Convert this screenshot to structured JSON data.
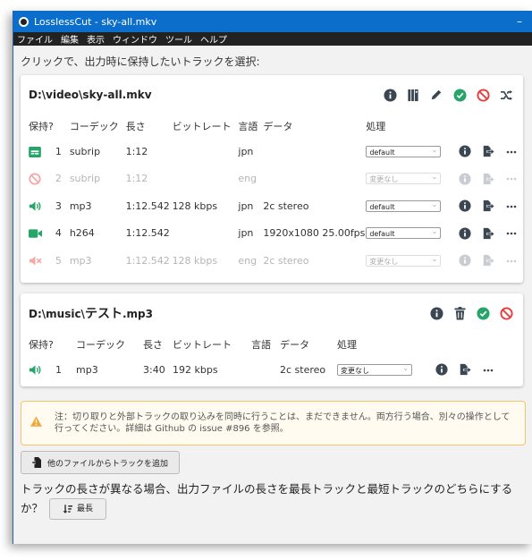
{
  "window": {
    "title": "LosslessCut - sky-all.mkv",
    "minimize": "–"
  },
  "menu": [
    "ファイル",
    "編集",
    "表示",
    "ウィンドウ",
    "ツール",
    "ヘルプ"
  ],
  "hint": "クリックで、出力時に保持したいトラックを選択:",
  "headers": {
    "keep": "保持?",
    "codec": "コーデック",
    "length": "長さ",
    "bitrate": "ビットレート",
    "lang": "言語",
    "data": "データ",
    "action": "処理"
  },
  "file1": {
    "path": "D:\\video\\sky-all.mkv",
    "tracks": [
      {
        "type": "subtitle",
        "index": "1",
        "codec": "subrip",
        "length": "1:12",
        "bitrate": "",
        "lang": "jpn",
        "data": "",
        "action": "default",
        "enabled": true
      },
      {
        "type": "disabled",
        "index": "2",
        "codec": "subrip",
        "length": "1:12",
        "bitrate": "",
        "lang": "eng",
        "data": "",
        "action": "変更なし",
        "enabled": false
      },
      {
        "type": "audio",
        "index": "3",
        "codec": "mp3",
        "length": "1:12.542",
        "bitrate": "128 kbps",
        "lang": "jpn",
        "data": "2c stereo",
        "action": "default",
        "enabled": true
      },
      {
        "type": "video",
        "index": "4",
        "codec": "h264",
        "length": "1:12.542",
        "bitrate": "",
        "lang": "jpn",
        "data": "1920x1080 25.00fps",
        "action": "default",
        "enabled": true
      },
      {
        "type": "muted",
        "index": "5",
        "codec": "mp3",
        "length": "1:12.542",
        "bitrate": "128 kbps",
        "lang": "eng",
        "data": "2c stereo",
        "action": "変更なし",
        "enabled": false
      }
    ]
  },
  "file2": {
    "path_prefix": "D:\\music\\",
    "path_name": "テスト",
    "path_ext": ".mp3",
    "tracks": [
      {
        "type": "audio",
        "index": "1",
        "codec": "mp3",
        "length": "3:40",
        "bitrate": "192 kbps",
        "lang": "",
        "data": "2c stereo",
        "action": "変更なし",
        "enabled": true
      }
    ]
  },
  "warning": "注：切り取りと外部トラックの取り込みを同時に行うことは、まだできません。両方行う場合、別々の操作として行ってください。詳細は Github の issue #896 を参照。",
  "add_track_button": "他のファイルからトラックを追加",
  "question": "トラックの長さが異なる場合、出力ファイルの長さを最長トラックと最短トラックのどちらにするか？",
  "longest_button": "最長",
  "colors": {
    "accent": "#26a569",
    "danger": "#e53e3e",
    "icon": "#3a4652",
    "titlebar": "#0b6ecb"
  }
}
